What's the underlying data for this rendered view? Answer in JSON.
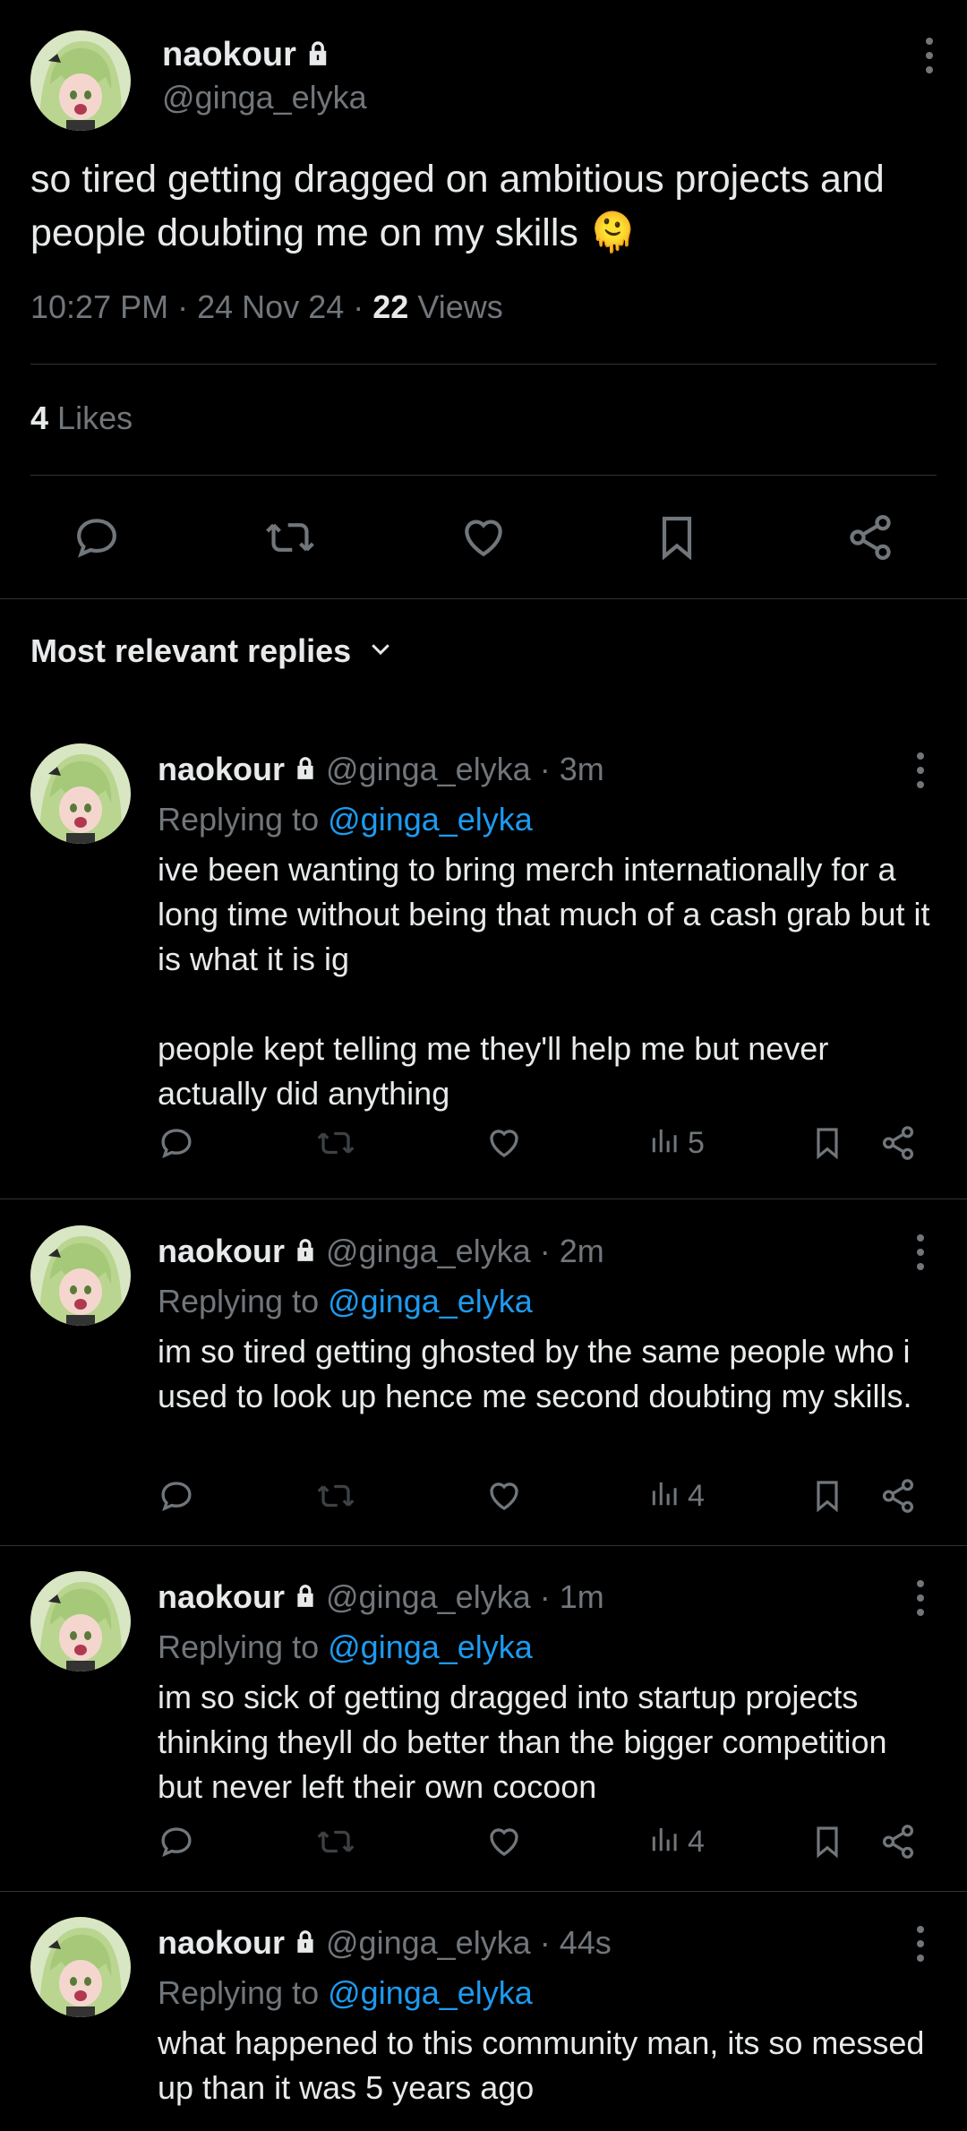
{
  "main_tweet": {
    "display_name": "naokour",
    "handle": "@ginga_elyka",
    "text": "so tired getting dragged on ambitious projects and people doubting me on my skills 🫠",
    "time": "10:27 PM",
    "sep": "·",
    "date": "24 Nov 24",
    "views_count": "22",
    "views_label": "Views",
    "likes_count": "4",
    "likes_label": "Likes"
  },
  "sort_label": "Most relevant replies",
  "replies": [
    {
      "display_name": "naokour",
      "handle": "@ginga_elyka",
      "time": "· 3m",
      "replying_prefix": "Replying to",
      "replying_to": "@ginga_elyka",
      "text": "ive been wanting to bring merch internationally for a long time without being that much of a cash grab but it is what it is ig\n\npeople kept telling me they'll help me but never actually did anything",
      "views": "5"
    },
    {
      "display_name": "naokour",
      "handle": "@ginga_elyka",
      "time": "· 2m",
      "replying_prefix": "Replying to",
      "replying_to": "@ginga_elyka",
      "text": "im so tired getting ghosted by the same people who i used to look up hence me second doubting my skills.",
      "views": "4"
    },
    {
      "display_name": "naokour",
      "handle": "@ginga_elyka",
      "time": "· 1m",
      "replying_prefix": "Replying to",
      "replying_to": "@ginga_elyka",
      "text": "im so sick of getting dragged into startup projects thinking theyll do better than the bigger competition but never left their own cocoon",
      "views": "4"
    },
    {
      "display_name": "naokour",
      "handle": "@ginga_elyka",
      "time": "· 44s",
      "replying_prefix": "Replying to",
      "replying_to": "@ginga_elyka",
      "text": "what happened to this community man, its so messed up than it was 5 years ago",
      "views": ""
    }
  ],
  "icons": {
    "lock": "lock-icon",
    "more": "more-vertical-icon",
    "reply": "reply-icon",
    "repost": "repost-icon",
    "like": "heart-icon",
    "bookmark": "bookmark-icon",
    "share": "share-icon",
    "views": "views-chart-icon",
    "chevron": "chevron-down-icon"
  },
  "colors": {
    "background": "#000000",
    "text": "#e7e9ea",
    "muted": "#71767b",
    "link": "#1d9bf0",
    "divider": "#2f3336"
  }
}
